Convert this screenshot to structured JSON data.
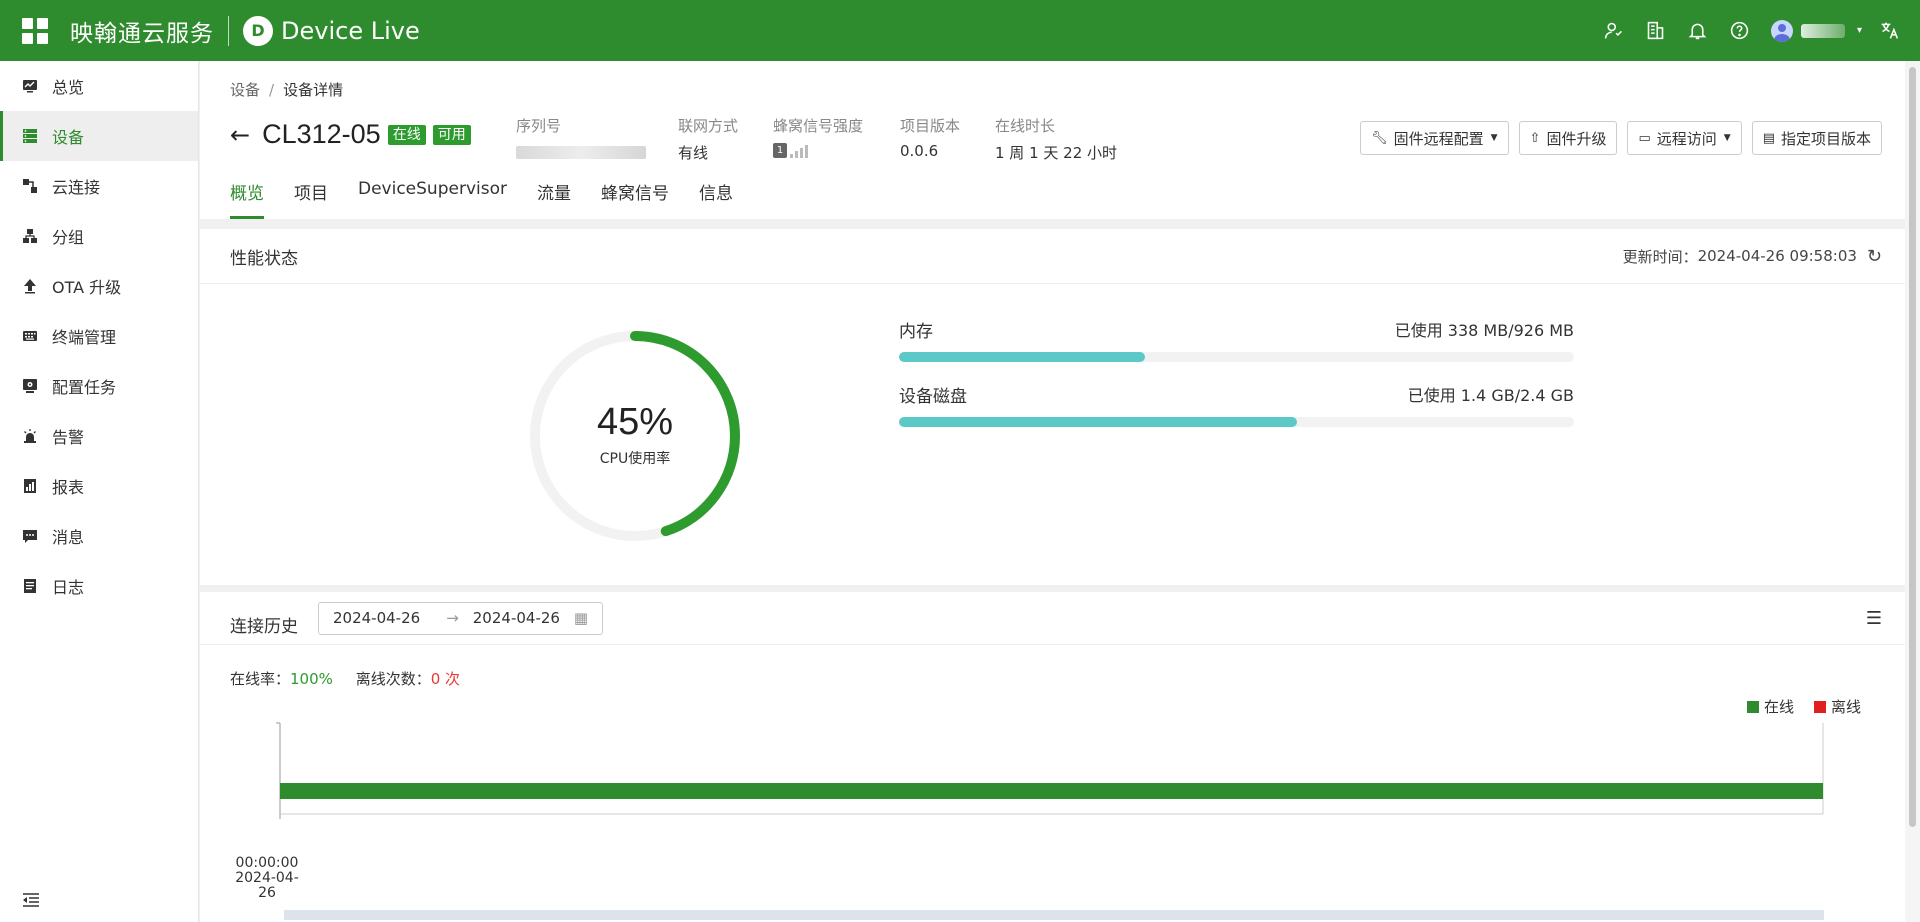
{
  "header": {
    "brand": "映翰通云服务",
    "product_logo": "D",
    "product": "Device Live",
    "user_name": "user"
  },
  "sidebar": {
    "items": [
      {
        "label": "总览",
        "icon": "dashboard-icon"
      },
      {
        "label": "设备",
        "icon": "devices-icon",
        "active": true
      },
      {
        "label": "云连接",
        "icon": "cloud-connect-icon"
      },
      {
        "label": "分组",
        "icon": "group-icon"
      },
      {
        "label": "OTA 升级",
        "icon": "upload-icon"
      },
      {
        "label": "终端管理",
        "icon": "keyboard-icon"
      },
      {
        "label": "配置任务",
        "icon": "config-task-icon"
      },
      {
        "label": "告警",
        "icon": "alarm-icon"
      },
      {
        "label": "报表",
        "icon": "report-icon"
      },
      {
        "label": "消息",
        "icon": "message-icon"
      },
      {
        "label": "日志",
        "icon": "log-icon"
      }
    ]
  },
  "breadcrumb": {
    "parent": "设备",
    "separator": "/",
    "current": "设备详情"
  },
  "device": {
    "title": "CL312-05",
    "badge_online": "在线",
    "badge_available": "可用",
    "meta": {
      "serial_label": "序列号",
      "network_label": "联网方式",
      "network_value": "有线",
      "signal_label": "蜂窝信号强度",
      "signal_sim": "1",
      "version_label": "项目版本",
      "version_value": "0.0.6",
      "uptime_label": "在线时长",
      "uptime_value": "1 周 1 天 22 小时"
    }
  },
  "actions": {
    "firmware_config": "固件远程配置",
    "firmware_upgrade": "固件升级",
    "remote_access": "远程访问",
    "assign_version": "指定项目版本"
  },
  "tabs": [
    "概览",
    "项目",
    "DeviceSupervisor",
    "流量",
    "蜂窝信号",
    "信息"
  ],
  "performance": {
    "title": "性能状态",
    "updated_label": "更新时间：",
    "updated_value": "2024-04-26 09:58:03",
    "cpu_percent": 45,
    "cpu_text": "45%",
    "cpu_label": "CPU使用率",
    "memory_label": "内存",
    "memory_used": "已使用 338 MB/926 MB",
    "memory_fraction": 0.365,
    "disk_label": "设备磁盘",
    "disk_used": "已使用 1.4 GB/2.4 GB",
    "disk_fraction": 0.59,
    "colors": {
      "gauge": "#2e9b2e",
      "bar": "#5cc9c9"
    }
  },
  "history": {
    "title": "连接历史",
    "date_start": "2024-04-26",
    "date_end": "2024-04-26",
    "online_rate_label": "在线率：",
    "online_rate_value": "100%",
    "offline_count_label": "离线次数：",
    "offline_count_value": "0 次",
    "legend_online": "在线",
    "legend_offline": "离线",
    "tick_time": "00:00:00",
    "tick_date": "2024-04-26",
    "colors": {
      "online": "#2e8b2e",
      "offline": "#e02020"
    }
  },
  "chart_data": {
    "type": "bar",
    "title": "",
    "categories": [
      "2024-04-26"
    ],
    "series": [
      {
        "name": "在线",
        "values": [
          100
        ]
      },
      {
        "name": "离线",
        "values": [
          0
        ]
      }
    ],
    "xlabel": "",
    "ylabel": "",
    "legend": "top-right",
    "grid": false
  }
}
